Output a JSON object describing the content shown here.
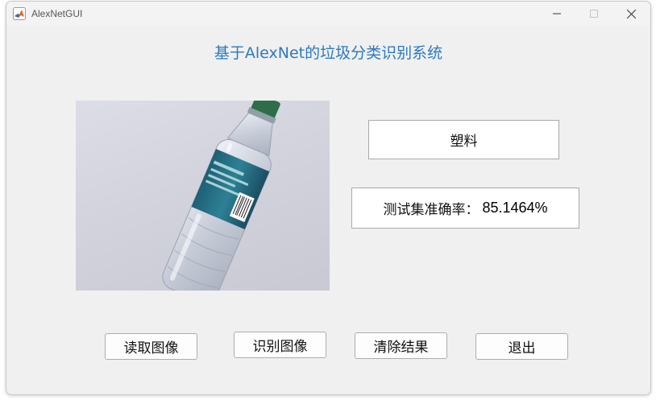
{
  "window": {
    "title": "AlexNetGUI",
    "icon": "matlab-logo-icon",
    "controls": [
      "minimize-icon",
      "maximize-icon",
      "close-icon"
    ]
  },
  "app": {
    "title": "基于AlexNet的垃圾分类识别系统",
    "title_color": "#2a7ac0"
  },
  "image": {
    "description_icon": "plastic-bottle-photo"
  },
  "result": {
    "category": "塑料"
  },
  "accuracy": {
    "label": "测试集准确率：",
    "value": "85.1464%"
  },
  "buttons": {
    "read": "读取图像",
    "recognize": "识别图像",
    "clear": "清除结果",
    "exit": "退出"
  }
}
